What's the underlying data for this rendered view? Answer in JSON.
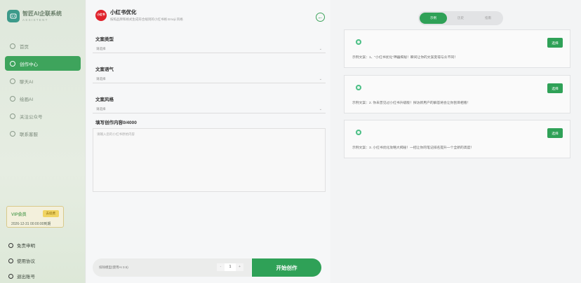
{
  "sidebar": {
    "brand_name": "智匠AI企联系统",
    "brand_sub": "ASSISTENT",
    "items": [
      {
        "label": "首页"
      },
      {
        "label": "创作中心"
      },
      {
        "label": "聊天AI"
      },
      {
        "label": "绘画AI"
      },
      {
        "label": "关注公众号"
      },
      {
        "label": "联系客服"
      }
    ],
    "vip_label": "VIP会员",
    "vip_button": "去续费",
    "vip_expire": "2026-12-31 00:00:00到期",
    "footer": [
      {
        "label": "免责申明"
      },
      {
        "label": "使用协议"
      },
      {
        "label": "退出账号"
      }
    ]
  },
  "form": {
    "logo_text": "小红书",
    "title": "小红书优化",
    "subtitle": "按照品牌和格式生成符合规则的小红书格 Emoji 风格",
    "fields": [
      {
        "label": "文案类型",
        "placeholder": "请选择"
      },
      {
        "label": "文案语气",
        "placeholder": "请选择"
      },
      {
        "label": "文案风格",
        "placeholder": "请选择"
      }
    ],
    "content_label": "填写创作内容0/4000",
    "content_placeholder": "请输入您的小红书原始内容",
    "bottom_text": "扣除模型(使用AI 3.5)",
    "qty_minus": "-",
    "qty_value": "1",
    "qty_plus": "+",
    "start_button": "开始创作"
  },
  "examples": {
    "tabs": [
      {
        "label": "示例"
      },
      {
        "label": "历史"
      },
      {
        "label": "指南"
      }
    ],
    "cards": [
      {
        "button": "选择",
        "text": "示例文案：1、\"小红书优化\"神器揭秘！瞬间让你的文案变得与众不同！"
      },
      {
        "button": "选择",
        "text": "示例文案：2. 你未曾见过小红书升级版！探访新用户的解答将会让你刮目相看！"
      },
      {
        "button": "选择",
        "text": "示例文案：3. 小红书优化攻略大揭秘！一招让你的笔记排名提升一个全新的高度！"
      }
    ]
  },
  "colors": {
    "accent": "#2fa157",
    "sidebar_bg": "#e3ebdf",
    "xhs_red": "#e0222b",
    "vip_gold": "#f0d463"
  }
}
